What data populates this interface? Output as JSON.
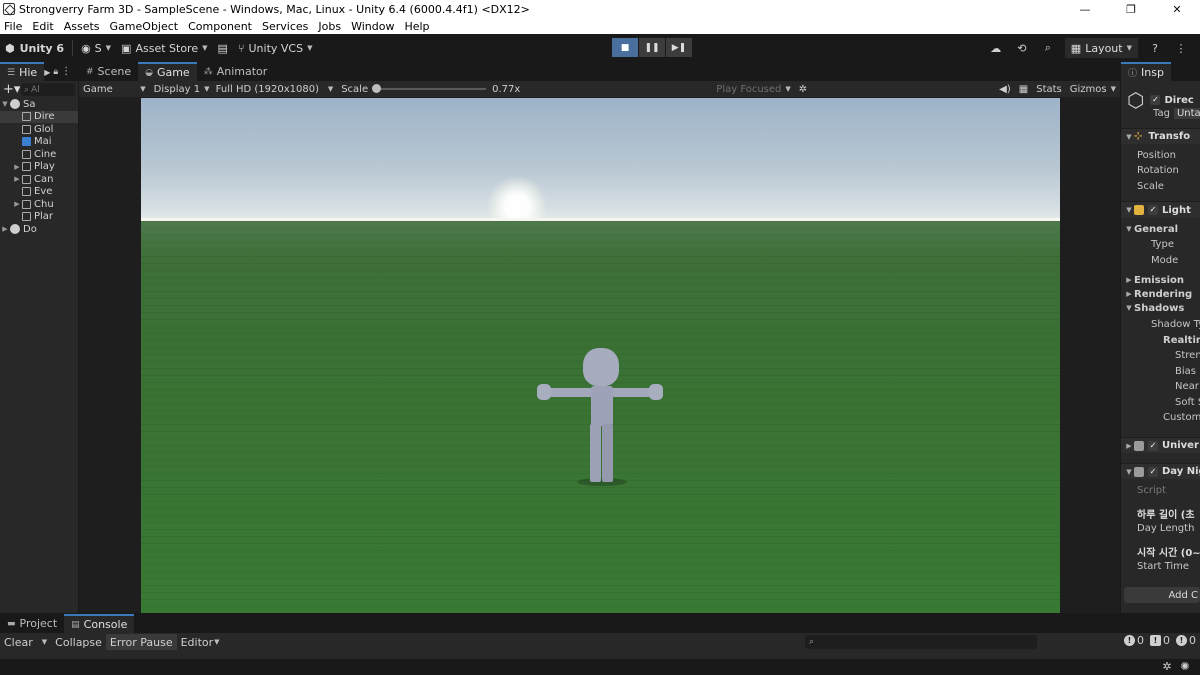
{
  "window": {
    "title": "Strongverry Farm 3D - SampleScene - Windows, Mac, Linux - Unity 6.4 (6000.4.4f1) <DX12>",
    "controls": [
      "—",
      "❐",
      "✕"
    ]
  },
  "menu": [
    "File",
    "Edit",
    "Assets",
    "GameObject",
    "Component",
    "Services",
    "Jobs",
    "Window",
    "Help"
  ],
  "toolbar": {
    "unity_label": "Unity 6",
    "account_label": "S",
    "asset_store_label": "Asset Store",
    "vcs_label": "Unity VCS",
    "layout_label": "Layout"
  },
  "hierarchy": {
    "tab_label": "Hie",
    "search_placeholder": "Al",
    "items": [
      {
        "label": "Sa",
        "depth": 0,
        "type": "scene",
        "expanded": true
      },
      {
        "label": "Dire",
        "depth": 1,
        "type": "object",
        "selected": true
      },
      {
        "label": "Glol",
        "depth": 1,
        "type": "object"
      },
      {
        "label": "Mai",
        "depth": 1,
        "type": "camera"
      },
      {
        "label": "Cine",
        "depth": 1,
        "type": "object"
      },
      {
        "label": "Play",
        "depth": 1,
        "type": "object",
        "collapsed": true
      },
      {
        "label": "Can",
        "depth": 1,
        "type": "object",
        "collapsed": true
      },
      {
        "label": "Eve",
        "depth": 1,
        "type": "object"
      },
      {
        "label": "Chu",
        "depth": 1,
        "type": "object",
        "collapsed": true
      },
      {
        "label": "Plar",
        "depth": 1,
        "type": "object"
      },
      {
        "label": "Do",
        "depth": 0,
        "type": "scene",
        "collapsed": true
      }
    ]
  },
  "center_tabs": [
    "Scene",
    "Game",
    "Animator"
  ],
  "game_toolbar": {
    "mode": "Game",
    "display": "Display 1",
    "resolution": "Full HD (1920x1080)",
    "scale_label": "Scale",
    "scale_value": "0.77x",
    "play_focused": "Play Focused",
    "stats": "Stats",
    "gizmos": "Gizmos"
  },
  "inspector": {
    "tab_label": "Insp",
    "object_name": "Direc",
    "tag_label": "Tag",
    "tag_value": "Untag",
    "transform_label": "Transfo",
    "transform_fields": [
      "Position",
      "Rotation",
      "Scale"
    ],
    "light_label": "Light",
    "general_label": "General",
    "general_fields": [
      "Type",
      "Mode"
    ],
    "emission_label": "Emission",
    "rendering_label": "Rendering",
    "shadows_label": "Shadows",
    "shadow_type_label": "Shadow Ty",
    "realtime_label": "Realtime",
    "realtime_fields": [
      "Streng",
      "Bias",
      "Near",
      "Soft S"
    ],
    "custom_label": "Custom",
    "universal_label": "Univer",
    "daynight_label": "Day Nig",
    "script_label": "Script",
    "day_length_korean": "하루 길이 (초",
    "day_length_label": "Day Length",
    "start_time_korean": "시작 시간 (0~1",
    "start_time_label": "Start Time",
    "add_component": "Add C"
  },
  "console": {
    "tabs": [
      "Project",
      "Console"
    ],
    "clear": "Clear",
    "collapse": "Collapse",
    "error_pause": "Error Pause",
    "editor": "Editor",
    "counts": {
      "errors": "0",
      "warnings": "0",
      "logs": "0"
    }
  }
}
